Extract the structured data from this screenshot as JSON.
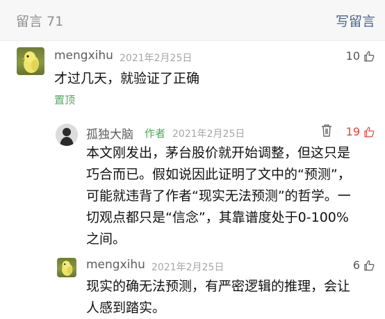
{
  "header": {
    "count_label": "留言 71",
    "write_label": "写留言"
  },
  "comment": {
    "author": "mengxihu",
    "date": "2021年2月25日",
    "text": "才过几天，就验证了正确",
    "pinned_label": "置顶",
    "likes": "10",
    "replies": [
      {
        "author": "孤独大脑",
        "author_tag": "作者",
        "date": "2021年2月25日",
        "lines": [
          "本文刚发出，茅台股价就开始调整，但这只是",
          "巧合而已。假如说因此证明了文中的“预测”，",
          "可能就违背了作者“现实无法预测”的哲学。一",
          "切观点都只是“信念”，其靠谱度处于0-100%",
          "之间。"
        ],
        "likes": "19",
        "liked": true,
        "color_liked": "#e64340"
      },
      {
        "author": "mengxihu",
        "date": "2021年2月25日",
        "lines": [
          "现实的确无法预测，有严密逻辑的推理，会让",
          "人感到踏实。"
        ],
        "likes": "6"
      }
    ]
  },
  "colors": {
    "link": "#4d6290",
    "author_tag": "#4aa95b",
    "pinned": "#55a75f",
    "liked": "#e64340"
  },
  "icons": {
    "like": "thumbs-up-icon",
    "delete": "trash-icon"
  }
}
